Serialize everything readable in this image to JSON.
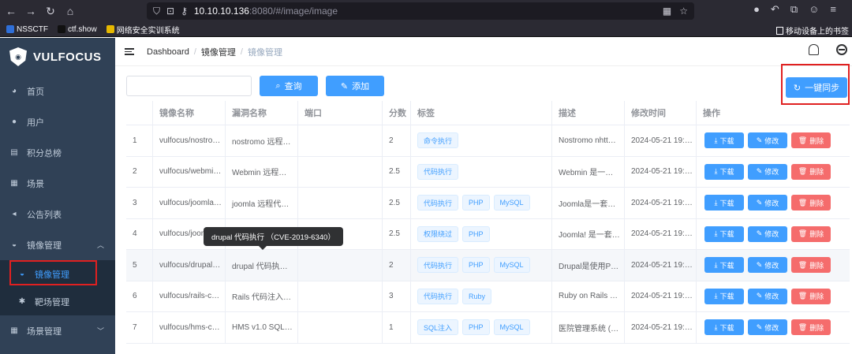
{
  "browser": {
    "url_host": "10.10.10.136",
    "url_rest": ":8080/#/image/image",
    "bookmarks": [
      "NSSCTF",
      "ctf.show",
      "网络安全实训系统"
    ],
    "bookmarks_right": "移动设备上的书签"
  },
  "app": {
    "logo_text": "VULFOCUS"
  },
  "sidebar": {
    "items": [
      {
        "label": "首页"
      },
      {
        "label": "用户"
      },
      {
        "label": "积分总榜"
      },
      {
        "label": "场景"
      },
      {
        "label": "公告列表"
      },
      {
        "label": "镜像管理"
      }
    ],
    "submenu": [
      {
        "label": "镜像管理"
      },
      {
        "label": "靶场管理"
      }
    ],
    "last": {
      "label": "场景管理"
    }
  },
  "breadcrumb": [
    "Dashboard",
    "镜像管理",
    "镜像管理"
  ],
  "toolbar": {
    "search_placeholder": "",
    "query_label": "查询",
    "add_label": "添加",
    "sync_label": "一键同步"
  },
  "table": {
    "headers": [
      "",
      "镜像名称",
      "漏洞名称",
      "端口",
      "分数",
      "标签",
      "描述",
      "修改时间",
      "操作"
    ],
    "rows": [
      {
        "no": "1",
        "image": "vulfocus/nostro…",
        "vuln": "nostromo 远程…",
        "port": "",
        "score": "2",
        "tags": [
          "命令执行"
        ],
        "desc": "Nostromo nhtt…",
        "time": "2024-05-21 19:…"
      },
      {
        "no": "2",
        "image": "vulfocus/webmi…",
        "vuln": "Webmin 远程…",
        "port": "",
        "score": "2.5",
        "tags": [
          "代码执行"
        ],
        "desc": "Webmin 是一…",
        "time": "2024-05-21 19:…"
      },
      {
        "no": "3",
        "image": "vulfocus/joomla…",
        "vuln": "joomla 远程代…",
        "port": "",
        "score": "2.5",
        "tags": [
          "代码执行",
          "PHP",
          "MySQL"
        ],
        "desc": "Joomla是一套…",
        "time": "2024-05-21 19:…"
      },
      {
        "no": "4",
        "image": "vulfocus/joom…",
        "vuln": "",
        "port": "",
        "score": "2.5",
        "tags": [
          "权限绕过",
          "PHP"
        ],
        "desc": "Joomla! 是一套…",
        "time": "2024-05-21 19:…"
      },
      {
        "no": "5",
        "image": "vulfocus/drupal…",
        "vuln": "drupal 代码执…",
        "port": "",
        "score": "2",
        "tags": [
          "代码执行",
          "PHP",
          "MySQL"
        ],
        "desc": "Drupal是使用P…",
        "time": "2024-05-21 19:…"
      },
      {
        "no": "6",
        "image": "vulfocus/rails-c…",
        "vuln": "Rails 代码注入…",
        "port": "",
        "score": "3",
        "tags": [
          "代码执行",
          "Ruby"
        ],
        "desc": "Ruby on Rails …",
        "time": "2024-05-21 19:…"
      },
      {
        "no": "7",
        "image": "vulfocus/hms-c…",
        "vuln": "HMS v1.0 SQL…",
        "port": "",
        "score": "1",
        "tags": [
          "SQL注入",
          "PHP",
          "MySQL"
        ],
        "desc": "医院管理系统 (…",
        "time": "2024-05-21 19:…"
      }
    ],
    "actions": {
      "download": "下载",
      "edit": "修改",
      "delete": "删除"
    }
  },
  "tooltip": "drupal 代码执行 （CVE-2019-6340）",
  "colors": {
    "primary": "#409eff",
    "danger": "#f56c6c",
    "sidebar": "#304156",
    "highlight": "#e02020"
  }
}
